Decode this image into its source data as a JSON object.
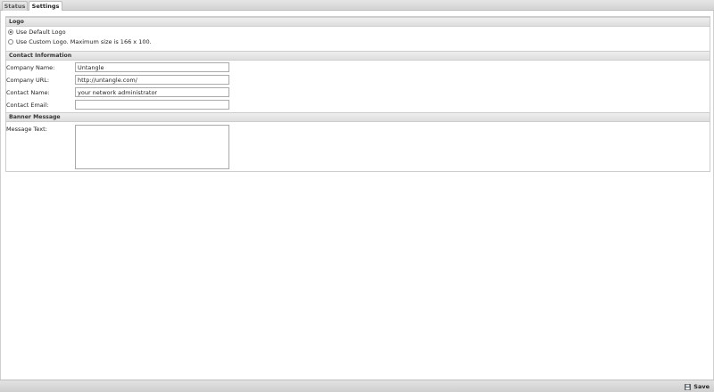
{
  "tabs": [
    {
      "label": "Status"
    },
    {
      "label": "Settings"
    }
  ],
  "logo": {
    "title": "Logo",
    "options": [
      {
        "label": "Use Default Logo",
        "checked": true
      },
      {
        "label": "Use Custom Logo. Maximum size is 166 x 100.",
        "checked": false
      }
    ]
  },
  "contact": {
    "title": "Contact Information",
    "company_name": {
      "label": "Company Name:",
      "value": "Untangle"
    },
    "company_url": {
      "label": "Company URL:",
      "value": "http://untangle.com/"
    },
    "contact_name": {
      "label": "Contact Name:",
      "value": "your network administrator"
    },
    "contact_email": {
      "label": "Contact Email:",
      "value": ""
    }
  },
  "banner": {
    "title": "Banner Message",
    "message_label": "Message Text:",
    "message_value": ""
  },
  "footer": {
    "save_label": "Save",
    "save_icon": "floppy-disk-icon"
  }
}
